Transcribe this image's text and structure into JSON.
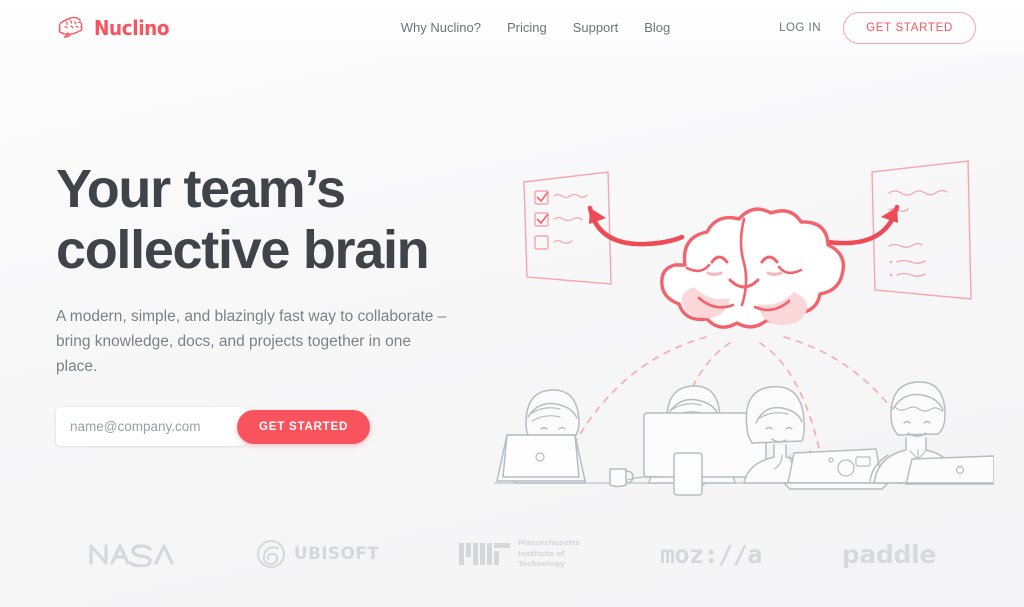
{
  "brand": {
    "name": "Nuclino",
    "logo_icon": "brain-speech-bubble-icon",
    "color": "#F9545E"
  },
  "header": {
    "nav": [
      {
        "label": "Why Nuclino?",
        "name": "why-nuclino"
      },
      {
        "label": "Pricing",
        "name": "pricing"
      },
      {
        "label": "Support",
        "name": "support"
      },
      {
        "label": "Blog",
        "name": "blog"
      }
    ],
    "login_label": "LOG IN",
    "get_started_label": "GET STARTED"
  },
  "hero": {
    "headline_line1": "Your team’s",
    "headline_line2": "collective brain",
    "subhead_line1": "A modern, simple, and blazingly fast way to collaborate –",
    "subhead_line2": "bring knowledge, docs, and projects together in one place.",
    "email_placeholder": "name@company.com",
    "email_value": "",
    "cta_label": "GET STARTED",
    "illustration": {
      "name": "collective-brain-illustration",
      "brain_icon": "smiling-cloud-brain-icon",
      "left_panel": "checklist-document",
      "right_panel": "notes-document",
      "people_count": 4,
      "line_color": "#F2636C",
      "people_color": "#B8BCC2"
    }
  },
  "clients": {
    "heading": "",
    "logos": [
      {
        "label": "NASA",
        "name": "nasa-logo"
      },
      {
        "label": "UBISOFT",
        "name": "ubisoft-logo"
      },
      {
        "label": "MIT",
        "name": "mit-logo",
        "sub": "Massachusetts\nInstitute of\nTechnology"
      },
      {
        "label": "moz://a",
        "name": "mozilla-logo"
      },
      {
        "label": "paddle",
        "name": "paddle-logo"
      }
    ],
    "mit_line1": "Massachusetts",
    "mit_line2": "Institute of",
    "mit_line3": "Technology",
    "mozilla_label": "moz://a",
    "paddle_label": "paddle",
    "ubisoft_label": "UBISOFT"
  }
}
